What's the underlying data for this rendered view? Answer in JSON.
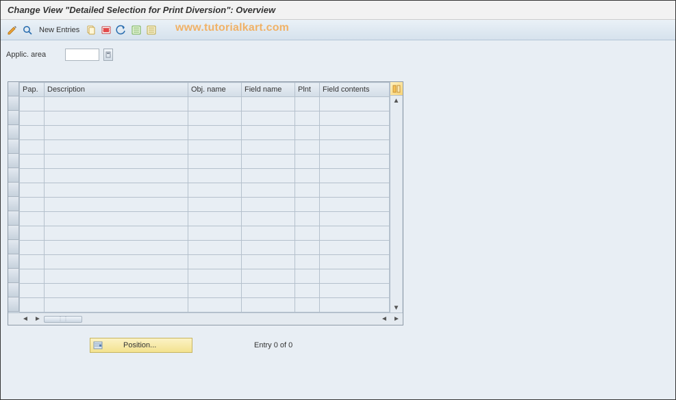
{
  "title": "Change View \"Detailed Selection for Print Diversion\": Overview",
  "toolbar": {
    "new_entries_label": "New Entries"
  },
  "watermark": "www.tutorialkart.com",
  "applic_area": {
    "label": "Applic. area",
    "value": ""
  },
  "grid": {
    "columns": [
      "Pap.",
      "Description",
      "Obj. name",
      "Field name",
      "Plnt",
      "Field contents"
    ],
    "row_count": 15
  },
  "footer": {
    "position_label": "Position...",
    "entry_text": "Entry 0 of 0"
  }
}
